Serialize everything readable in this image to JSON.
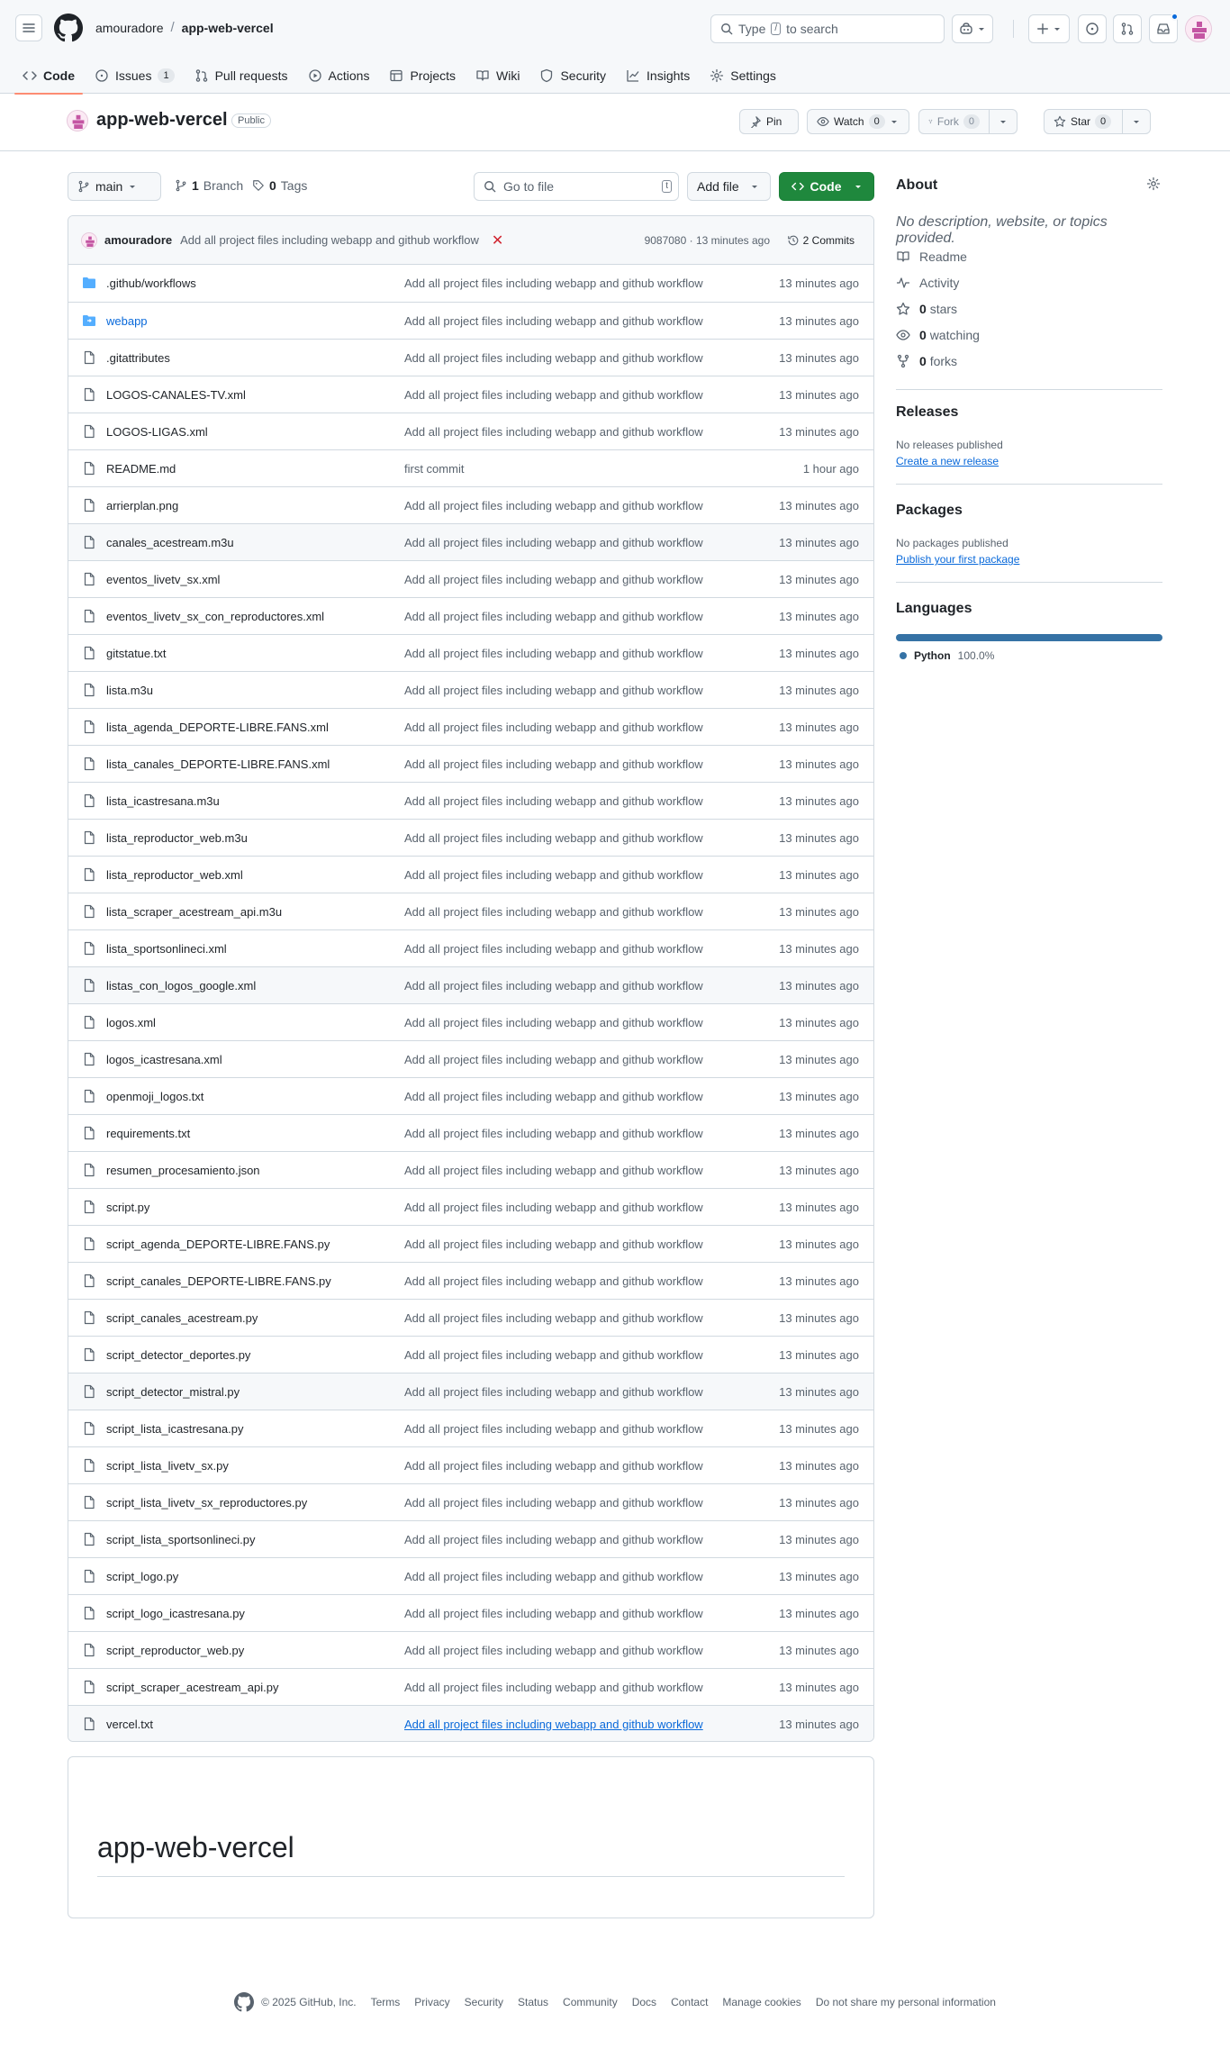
{
  "header": {
    "owner": "amouradore",
    "separator": "/",
    "repo": "app-web-vercel",
    "search_prefix": "Type",
    "search_key": "/",
    "search_suffix": "to search"
  },
  "tabs": [
    {
      "label": "Code",
      "icon": "code-icon"
    },
    {
      "label": "Issues",
      "icon": "issue-opened-icon",
      "count": "1"
    },
    {
      "label": "Pull requests",
      "icon": "git-pull-request-icon"
    },
    {
      "label": "Actions",
      "icon": "play-icon"
    },
    {
      "label": "Projects",
      "icon": "table-icon"
    },
    {
      "label": "Wiki",
      "icon": "book-icon"
    },
    {
      "label": "Security",
      "icon": "shield-icon"
    },
    {
      "label": "Insights",
      "icon": "graph-icon"
    },
    {
      "label": "Settings",
      "icon": "gear-icon"
    }
  ],
  "repo_head": {
    "title": "app-web-vercel",
    "visibility": "Public",
    "pin_label": "Pin",
    "watch_label": "Watch",
    "watch_count": "0",
    "fork_label": "Fork",
    "fork_count": "0",
    "star_label": "Star",
    "star_count": "0"
  },
  "toolbar": {
    "branch": "main",
    "branch_count": "1",
    "branch_label": "Branch",
    "tag_count": "0",
    "tag_label": "Tags",
    "goto_placeholder": "Go to file",
    "goto_key": "t",
    "add_file": "Add file",
    "code_button": "Code"
  },
  "commit": {
    "author": "amouradore",
    "message": "Add all project files including webapp and github workflow",
    "status": "✕",
    "hash_time": "9087080 · 13 minutes ago",
    "commits_label": "2 Commits"
  },
  "files": [
    {
      "name": ".github/workflows",
      "type": "dir",
      "msg": "Add all project files including webapp and github workflow",
      "time": "13 minutes ago"
    },
    {
      "name": "webapp",
      "type": "dir",
      "msg": "Add all project files including webapp and github workflow",
      "time": "13 minutes ago"
    },
    {
      "name": ".gitattributes",
      "type": "file",
      "msg": "Add all project files including webapp and github workflow",
      "time": "13 minutes ago"
    },
    {
      "name": "LOGOS-CANALES-TV.xml",
      "type": "file",
      "msg": "Add all project files including webapp and github workflow",
      "time": "13 minutes ago"
    },
    {
      "name": "LOGOS-LIGAS.xml",
      "type": "file",
      "msg": "Add all project files including webapp and github workflow",
      "time": "13 minutes ago"
    },
    {
      "name": "README.md",
      "type": "file",
      "msg": "first commit",
      "time": "1 hour ago"
    },
    {
      "name": "arrierplan.png",
      "type": "file",
      "msg": "Add all project files including webapp and github workflow",
      "time": "13 minutes ago"
    },
    {
      "name": "canales_acestream.m3u",
      "type": "file",
      "msg": "Add all project files including webapp and github workflow",
      "time": "13 minutes ago"
    },
    {
      "name": "eventos_livetv_sx.xml",
      "type": "file",
      "msg": "Add all project files including webapp and github workflow",
      "time": "13 minutes ago"
    },
    {
      "name": "eventos_livetv_sx_con_reproductores.xml",
      "type": "file",
      "msg": "Add all project files including webapp and github workflow",
      "time": "13 minutes ago"
    },
    {
      "name": "gitstatue.txt",
      "type": "file",
      "msg": "Add all project files including webapp and github workflow",
      "time": "13 minutes ago"
    },
    {
      "name": "lista.m3u",
      "type": "file",
      "msg": "Add all project files including webapp and github workflow",
      "time": "13 minutes ago"
    },
    {
      "name": "lista_agenda_DEPORTE-LIBRE.FANS.xml",
      "type": "file",
      "msg": "Add all project files including webapp and github workflow",
      "time": "13 minutes ago"
    },
    {
      "name": "lista_canales_DEPORTE-LIBRE.FANS.xml",
      "type": "file",
      "msg": "Add all project files including webapp and github workflow",
      "time": "13 minutes ago"
    },
    {
      "name": "lista_icastresana.m3u",
      "type": "file",
      "msg": "Add all project files including webapp and github workflow",
      "time": "13 minutes ago"
    },
    {
      "name": "lista_reproductor_web.m3u",
      "type": "file",
      "msg": "Add all project files including webapp and github workflow",
      "time": "13 minutes ago"
    },
    {
      "name": "lista_reproductor_web.xml",
      "type": "file",
      "msg": "Add all project files including webapp and github workflow",
      "time": "13 minutes ago"
    },
    {
      "name": "lista_scraper_acestream_api.m3u",
      "type": "file",
      "msg": "Add all project files including webapp and github workflow",
      "time": "13 minutes ago"
    },
    {
      "name": "lista_sportsonlineci.xml",
      "type": "file",
      "msg": "Add all project files including webapp and github workflow",
      "time": "13 minutes ago"
    },
    {
      "name": "listas_con_logos_google.xml",
      "type": "file",
      "msg": "Add all project files including webapp and github workflow",
      "time": "13 minutes ago"
    },
    {
      "name": "logos.xml",
      "type": "file",
      "msg": "Add all project files including webapp and github workflow",
      "time": "13 minutes ago"
    },
    {
      "name": "logos_icastresana.xml",
      "type": "file",
      "msg": "Add all project files including webapp and github workflow",
      "time": "13 minutes ago"
    },
    {
      "name": "openmoji_logos.txt",
      "type": "file",
      "msg": "Add all project files including webapp and github workflow",
      "time": "13 minutes ago"
    },
    {
      "name": "requirements.txt",
      "type": "file",
      "msg": "Add all project files including webapp and github workflow",
      "time": "13 minutes ago"
    },
    {
      "name": "resumen_procesamiento.json",
      "type": "file",
      "msg": "Add all project files including webapp and github workflow",
      "time": "13 minutes ago"
    },
    {
      "name": "script.py",
      "type": "file",
      "msg": "Add all project files including webapp and github workflow",
      "time": "13 minutes ago"
    },
    {
      "name": "script_agenda_DEPORTE-LIBRE.FANS.py",
      "type": "file",
      "msg": "Add all project files including webapp and github workflow",
      "time": "13 minutes ago"
    },
    {
      "name": "script_canales_DEPORTE-LIBRE.FANS.py",
      "type": "file",
      "msg": "Add all project files including webapp and github workflow",
      "time": "13 minutes ago"
    },
    {
      "name": "script_canales_acestream.py",
      "type": "file",
      "msg": "Add all project files including webapp and github workflow",
      "time": "13 minutes ago"
    },
    {
      "name": "script_detector_deportes.py",
      "type": "file",
      "msg": "Add all project files including webapp and github workflow",
      "time": "13 minutes ago"
    },
    {
      "name": "script_detector_mistral.py",
      "type": "file",
      "msg": "Add all project files including webapp and github workflow",
      "time": "13 minutes ago"
    },
    {
      "name": "script_lista_icastresana.py",
      "type": "file",
      "msg": "Add all project files including webapp and github workflow",
      "time": "13 minutes ago"
    },
    {
      "name": "script_lista_livetv_sx.py",
      "type": "file",
      "msg": "Add all project files including webapp and github workflow",
      "time": "13 minutes ago"
    },
    {
      "name": "script_lista_livetv_sx_reproductores.py",
      "type": "file",
      "msg": "Add all project files including webapp and github workflow",
      "time": "13 minutes ago"
    },
    {
      "name": "script_lista_sportsonlineci.py",
      "type": "file",
      "msg": "Add all project files including webapp and github workflow",
      "time": "13 minutes ago"
    },
    {
      "name": "script_logo.py",
      "type": "file",
      "msg": "Add all project files including webapp and github workflow",
      "time": "13 minutes ago"
    },
    {
      "name": "script_logo_icastresana.py",
      "type": "file",
      "msg": "Add all project files including webapp and github workflow",
      "time": "13 minutes ago"
    },
    {
      "name": "script_reproductor_web.py",
      "type": "file",
      "msg": "Add all project files including webapp and github workflow",
      "time": "13 minutes ago"
    },
    {
      "name": "script_scraper_acestream_api.py",
      "type": "file",
      "msg": "Add all project files including webapp and github workflow",
      "time": "13 minutes ago"
    },
    {
      "name": "vercel.txt",
      "type": "file",
      "msg": "Add all project files including webapp and github workflow",
      "time": "13 minutes ago"
    }
  ],
  "readme": {
    "heading": "app-web-vercel"
  },
  "about": {
    "title": "About",
    "description": "No description, website, or topics provided.",
    "readme": "Readme",
    "activity": "Activity",
    "stars_count": "0",
    "stars_label": "stars",
    "watching_count": "0",
    "watching_label": "watching",
    "forks_count": "0",
    "forks_label": "forks"
  },
  "releases": {
    "title": "Releases",
    "note": "No releases published",
    "link": "Create a new release"
  },
  "packages": {
    "title": "Packages",
    "note": "No packages published",
    "link": "Publish your first package"
  },
  "languages": {
    "title": "Languages",
    "items": [
      {
        "name": "Python",
        "percent": "100.0%",
        "share": 1.0,
        "color": "#3572A5"
      }
    ]
  },
  "footer": {
    "copyright": "© 2025 GitHub, Inc.",
    "links": [
      "Terms",
      "Privacy",
      "Security",
      "Status",
      "Community",
      "Docs",
      "Contact",
      "Manage cookies",
      "Do not share my personal information"
    ]
  },
  "colors": {
    "accent": "#0969da",
    "primary_button": "#1f883d",
    "tab_underline": "#fd8c73",
    "error": "#d1242f"
  }
}
